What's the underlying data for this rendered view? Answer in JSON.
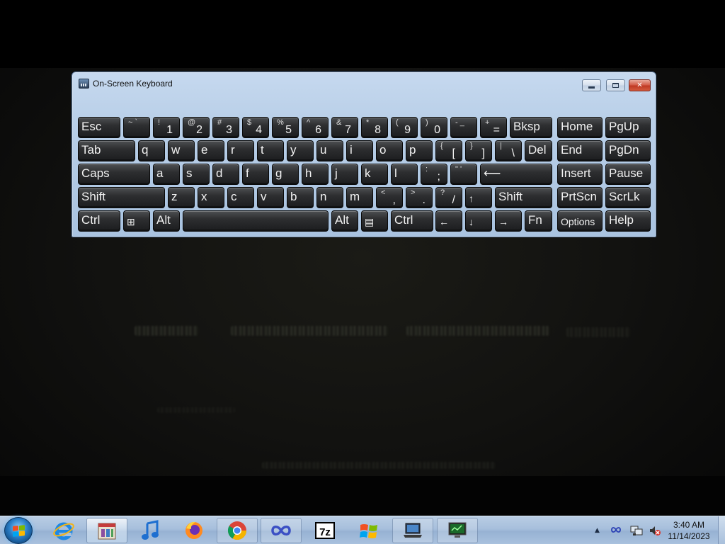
{
  "window": {
    "title": "On-Screen Keyboard",
    "controls": {
      "minimize": "",
      "maximize": "",
      "close": "✕"
    }
  },
  "keys": {
    "esc": "Esc",
    "tilde_sec": "~ `",
    "d1_sec": "!",
    "d1": "1",
    "d2_sec": "@",
    "d2": "2",
    "d3_sec": "#",
    "d3": "3",
    "d4_sec": "$",
    "d4": "4",
    "d5_sec": "%",
    "d5": "5",
    "d6_sec": "^",
    "d6": "6",
    "d7_sec": "&",
    "d7": "7",
    "d8_sec": "*",
    "d8": "8",
    "d9_sec": "(",
    "d9": "9",
    "d0_sec": ")",
    "d0": "0",
    "minus_sec": "- _",
    "plus_sec": "+",
    "equals": "=",
    "bksp": "Bksp",
    "home": "Home",
    "pgup": "PgUp",
    "tab": "Tab",
    "q": "q",
    "w": "w",
    "e": "e",
    "r": "r",
    "t": "t",
    "y": "y",
    "u": "u",
    "i": "i",
    "o": "o",
    "p": "p",
    "lbracket_sec": "{",
    "lbracket": "[",
    "rbracket_sec": "}",
    "rbracket": "]",
    "backslash_sec": "|",
    "backslash": "\\",
    "del": "Del",
    "end": "End",
    "pgdn": "PgDn",
    "caps": "Caps",
    "a": "a",
    "s": "s",
    "d": "d",
    "f": "f",
    "g": "g",
    "h": "h",
    "j": "j",
    "k": "k",
    "l": "l",
    "semicolon_sec": ":",
    "semicolon": ";",
    "quote_sec": "\" '",
    "enter": "⟵",
    "insert": "Insert",
    "pause": "Pause",
    "shift": "Shift",
    "z": "z",
    "x": "x",
    "c": "c",
    "v": "v",
    "b": "b",
    "n": "n",
    "m": "m",
    "comma_sec": "<",
    "comma": ",",
    "period_sec": ">",
    "period": ".",
    "slash_sec": "?",
    "slash": "/",
    "up": "↑",
    "shift_r": "Shift",
    "prtscn": "PrtScn",
    "scrlk": "ScrLk",
    "ctrl": "Ctrl",
    "win": "⊞",
    "alt": "Alt",
    "alt_r": "Alt",
    "menu": "▤",
    "ctrl_r": "Ctrl",
    "left": "←",
    "down": "↓",
    "right": "→",
    "fn": "Fn",
    "options": "Options",
    "help": "Help"
  },
  "taskbar": {
    "items": [
      "start",
      "internet-explorer",
      "app-store-box",
      "music",
      "firefox",
      "chrome",
      "infinity-app",
      "7zip",
      "windows-flag-app",
      "laptop-app",
      "monitor-app"
    ],
    "tray_arrow": "▲",
    "clock": {
      "time": "3:40 AM",
      "date": "11/14/2023"
    }
  }
}
